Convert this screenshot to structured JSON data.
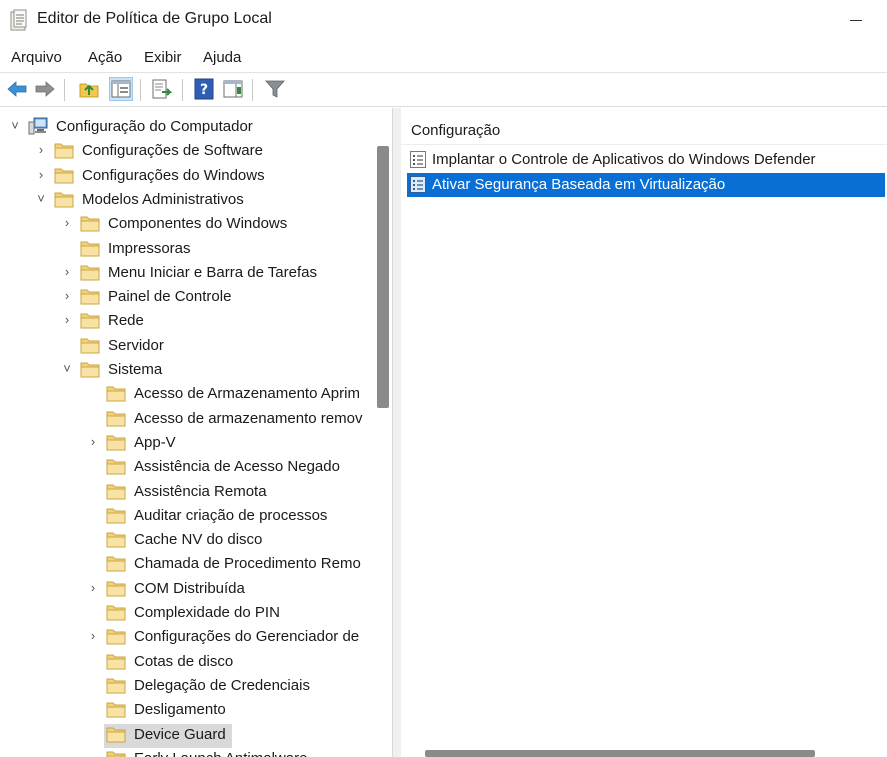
{
  "window": {
    "title": "Editor de Política de Grupo Local"
  },
  "menu": [
    "Arquivo",
    "Ação",
    "Exibir",
    "Ajuda"
  ],
  "toolbar": {
    "buttons": [
      "back-icon",
      "forward-icon",
      "up-folder-icon",
      "show-hide-tree-icon",
      "export-list-icon",
      "help-icon",
      "show-hide-action-pane-icon",
      "filter-icon"
    ]
  },
  "tree": {
    "items": [
      {
        "label": "Configuração do Computador",
        "expander": "expanded",
        "icon": "computer-icon"
      },
      {
        "label": "Configurações de Software",
        "expander": "collapsed",
        "icon": "folder-icon"
      },
      {
        "label": "Configurações do Windows",
        "expander": "collapsed",
        "icon": "folder-icon"
      },
      {
        "label": "Modelos Administrativos",
        "expander": "expanded",
        "icon": "folder-icon"
      },
      {
        "label": "Componentes do Windows",
        "expander": "collapsed",
        "icon": "folder-icon"
      },
      {
        "label": "Impressoras",
        "expander": "none",
        "icon": "folder-icon"
      },
      {
        "label": "Menu Iniciar e Barra de Tarefas",
        "expander": "collapsed",
        "icon": "folder-icon"
      },
      {
        "label": "Painel de Controle",
        "expander": "collapsed",
        "icon": "folder-icon"
      },
      {
        "label": "Rede",
        "expander": "collapsed",
        "icon": "folder-icon"
      },
      {
        "label": "Servidor",
        "expander": "none",
        "icon": "folder-icon"
      },
      {
        "label": "Sistema",
        "expander": "expanded",
        "icon": "folder-icon"
      },
      {
        "label": "Acesso de Armazenamento Aprim",
        "expander": "none",
        "icon": "folder-icon"
      },
      {
        "label": "Acesso de armazenamento remov",
        "expander": "none",
        "icon": "folder-icon"
      },
      {
        "label": "App-V",
        "expander": "collapsed",
        "icon": "folder-icon"
      },
      {
        "label": "Assistência de Acesso Negado",
        "expander": "none",
        "icon": "folder-icon"
      },
      {
        "label": "Assistência Remota",
        "expander": "none",
        "icon": "folder-icon"
      },
      {
        "label": "Auditar criação de processos",
        "expander": "none",
        "icon": "folder-icon"
      },
      {
        "label": "Cache NV do disco",
        "expander": "none",
        "icon": "folder-icon"
      },
      {
        "label": "Chamada de Procedimento Remo",
        "expander": "none",
        "icon": "folder-icon"
      },
      {
        "label": "COM Distribuída",
        "expander": "collapsed",
        "icon": "folder-icon"
      },
      {
        "label": "Complexidade do PIN",
        "expander": "none",
        "icon": "folder-icon"
      },
      {
        "label": "Configurações do Gerenciador de",
        "expander": "collapsed",
        "icon": "folder-icon"
      },
      {
        "label": "Cotas de disco",
        "expander": "none",
        "icon": "folder-icon"
      },
      {
        "label": "Delegação de Credenciais",
        "expander": "none",
        "icon": "folder-icon"
      },
      {
        "label": "Desligamento",
        "expander": "none",
        "icon": "folder-icon"
      },
      {
        "label": "Device Guard",
        "expander": "none",
        "icon": "folder-icon",
        "selected": true
      },
      {
        "label": "Early Launch Antimalware",
        "expander": "none",
        "icon": "folder-icon"
      }
    ]
  },
  "details": {
    "column_header": "Configuração",
    "policies": [
      {
        "label": "Implantar o Controle de Aplicativos do Windows Defender",
        "icon": "policy-setting-icon"
      },
      {
        "label": "Ativar Segurança Baseada em Virtualização",
        "icon": "policy-setting-icon",
        "selected": true
      }
    ]
  },
  "colors": {
    "selection_blue": "#0a6fd4",
    "tree_selected": "#d9d9d9",
    "folder_yellow": "#f4d27a"
  }
}
